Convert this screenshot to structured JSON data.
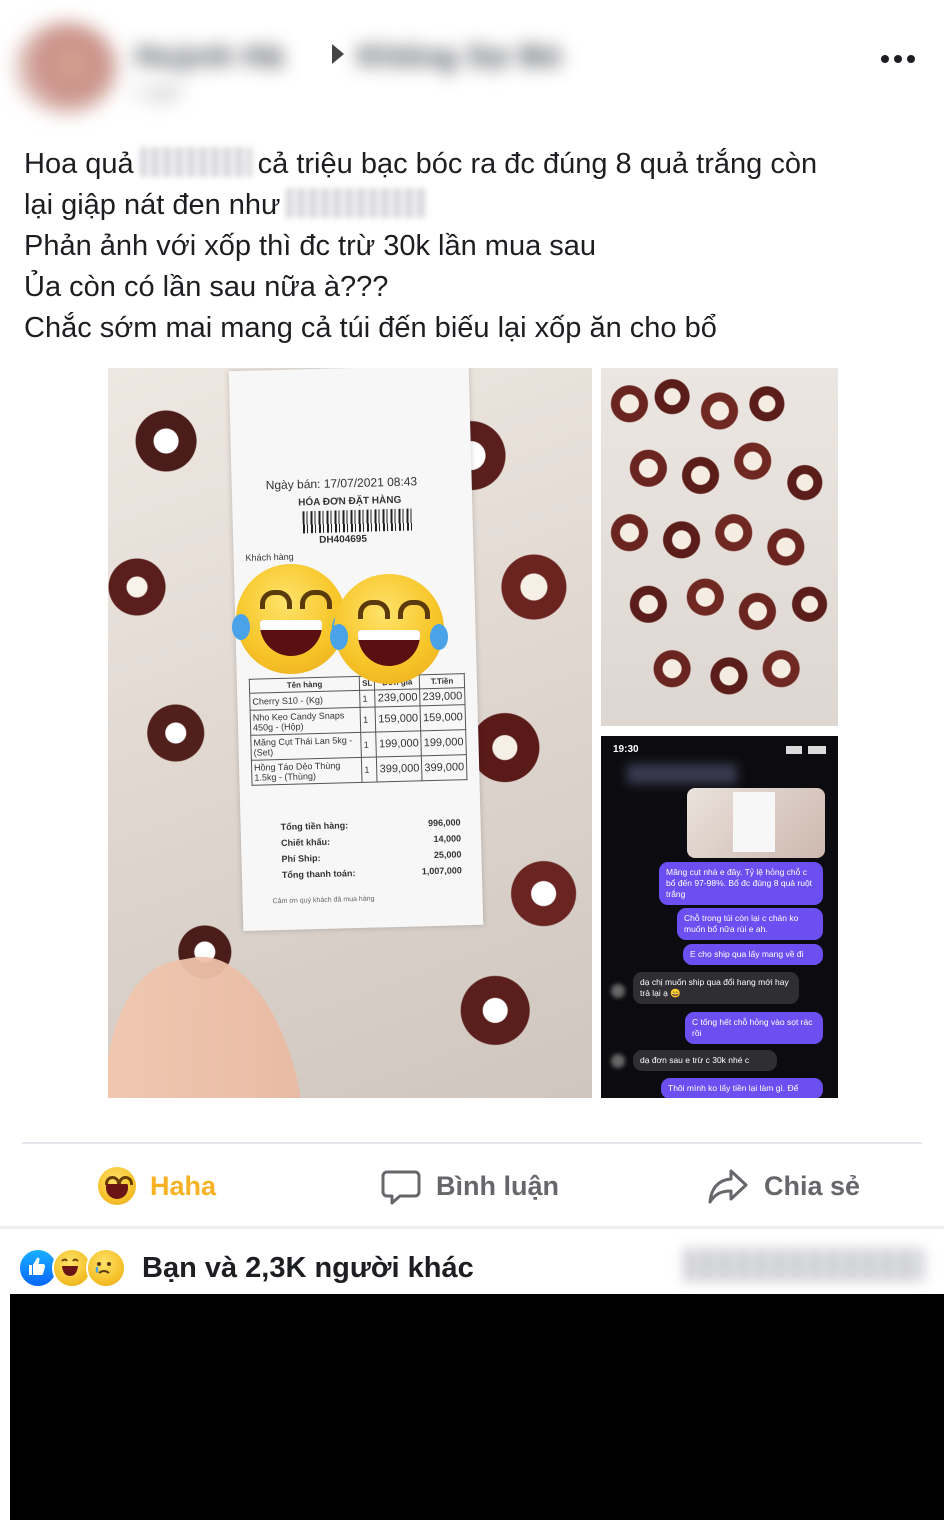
{
  "post": {
    "author_name": "Huỳnh Hà",
    "group_name": "Không Sợ Bỏ",
    "meta": "2 giờ",
    "more_label": "•••",
    "text_lines": {
      "l1a": "Hoa quả",
      "l1b": "cả triệu bạc bóc ra đc đúng 8 quả trắng còn",
      "l2": "lại giập nát đen như",
      "l3": "Phản ảnh với xốp thì đc trừ 30k lần mua sau",
      "l4": "Ủa còn có lần sau nữa à???",
      "l5": "Chắc sớm mai mang cả túi đến biếu lại xốp ăn cho bổ"
    }
  },
  "receipt": {
    "date": "Ngày bán: 17/07/2021 08:43",
    "title": "HÓA ĐƠN ĐẶT HÀNG",
    "code": "DH404695",
    "customer_label": "Khách hàng",
    "headers": [
      "Tên hàng",
      "SL",
      "Đơn giá",
      "T.Tiền"
    ],
    "rows": [
      [
        "Cherry S10 - (Kg)",
        "1",
        "239,000",
        "239,000"
      ],
      [
        "Nho Kẹo Candy Snaps 450g - (Hộp)",
        "1",
        "159,000",
        "159,000"
      ],
      [
        "Măng Cụt Thái Lan 5kg - (Set)",
        "1",
        "199,000",
        "199,000"
      ],
      [
        "Hồng Táo Dẻo Thùng 1.5kg - (Thùng)",
        "1",
        "399,000",
        "399,000"
      ]
    ],
    "totals": [
      [
        "Tổng tiền hàng:",
        "996,000"
      ],
      [
        "Chiết khấu:",
        "14,000"
      ],
      [
        "Phí Ship:",
        "25,000"
      ],
      [
        "Tổng thanh toán:",
        "1,007,000"
      ]
    ],
    "thanks": "Cảm ơn quý khách đã mua hàng"
  },
  "chat": {
    "time": "19:30",
    "m1": "Măng cụt nhà e đây. Tỷ lệ hỏng chỗ c bổ đến 97-98%. Bổ đc đúng 8 quả ruột trắng",
    "m2": "Chỗ trong túi còn lại c chán ko muốn bổ nữa rùi e ah.",
    "m3": "E cho ship qua lấy mang về đi",
    "m4": "dạ chị muốn ship qua đổi hang mới hay trả lại ạ 😄",
    "m5": "C tống hết chỗ hỏng vào sọt rác rồi",
    "m6": "dạ đơn sau e trừ c 30k nhé c",
    "m7": "Thôi mình ko lấy tiền lại làm gì. Để"
  },
  "actions": {
    "haha": "Haha",
    "comment": "Bình luận",
    "share": "Chia sẻ"
  },
  "reactions": {
    "summary": "Bạn và 2,3K người khác",
    "icons": [
      "like-icon",
      "haha-icon",
      "sad-icon"
    ]
  },
  "colors": {
    "haha": "#f7b125",
    "muted": "#65676b",
    "chat_out": "#6b4ff0"
  }
}
